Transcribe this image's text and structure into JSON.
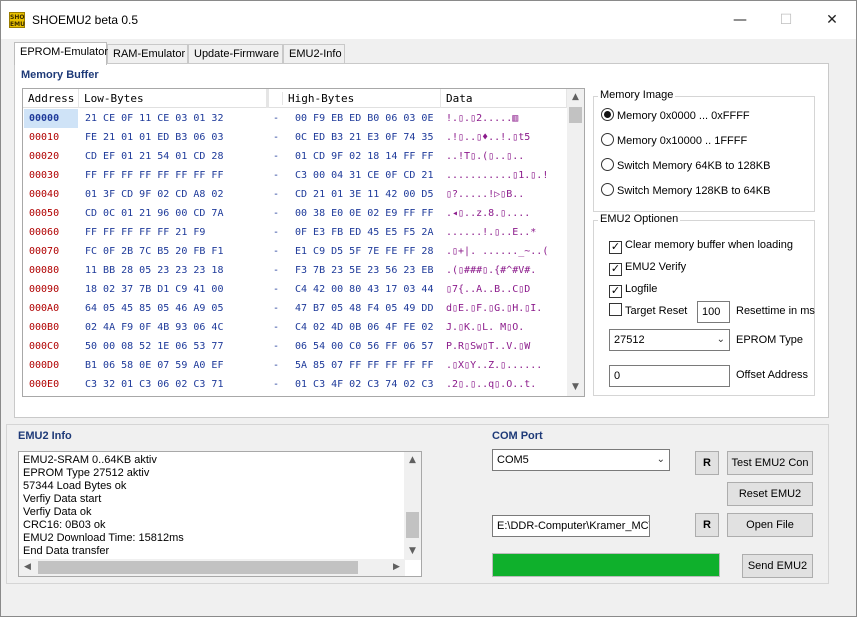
{
  "window": {
    "title": "SHOEMU2 beta 0.5",
    "icon_text": "SHO EMU",
    "minimize": "—",
    "maximize": "☐",
    "close": "✕"
  },
  "tabs": [
    {
      "label": "EPROM-Emulator",
      "active": true
    },
    {
      "label": "RAM-Emulator",
      "active": false
    },
    {
      "label": "Update-Firmware",
      "active": false
    },
    {
      "label": "EMU2-Info",
      "active": false
    }
  ],
  "memory_buffer": {
    "title": "Memory Buffer",
    "headers": [
      "Address",
      "Low-Bytes",
      "",
      "High-Bytes",
      "Data"
    ],
    "rows": [
      {
        "address": "00000",
        "low": "21 CE 0F 11 CE 03 01 32",
        "sep": "-",
        "high": "00 F9 EB ED B0 06 03 0E",
        "data": "!.▯.▯2.....▥"
      },
      {
        "address": "00010",
        "low": "FE 21 01 01 ED B3 06 03",
        "sep": "-",
        "high": "0C ED B3 21 E3 0F 74 35",
        "data": ".!▯..▯♦..!.▯t5"
      },
      {
        "address": "00020",
        "low": "CD EF 01 21 54 01 CD 28",
        "sep": "-",
        "high": "01 CD 9F 02 18 14 FF FF",
        "data": "..!T▯.(▯..▯.."
      },
      {
        "address": "00030",
        "low": "FF FF FF FF FF FF FF FF",
        "sep": "-",
        "high": "C3 00 04 31 CE 0F CD 21",
        "data": "...........▯1.▯.!"
      },
      {
        "address": "00040",
        "low": "01 3F CD 9F 02 CD A8 02",
        "sep": "-",
        "high": "CD 21 01 3E 11 42 00 D5",
        "data": "▯?.....!▷▯B.."
      },
      {
        "address": "00050",
        "low": "CD 0C 01 21 96 00 CD 7A",
        "sep": "-",
        "high": "00 38 E0 0E 02 E9 FF FF",
        "data": ".◂▯..z.8.▯...."
      },
      {
        "address": "00060",
        "low": "FF FF FF FF FF 21 F9",
        "sep": "-",
        "high": "0F E3 FB ED 45 E5 F5 2A",
        "data": "......!.▯..E..*"
      },
      {
        "address": "00070",
        "low": "FC 0F 2B 7C B5 20 FB F1",
        "sep": "-",
        "high": "E1 C9 D5 5F 7E FE FF 28",
        "data": ".▯+|. ......_~..("
      },
      {
        "address": "00080",
        "low": "11 BB 28 05 23 23 23 18",
        "sep": "-",
        "high": "F3 7B 23 5E 23 56 23 EB",
        "data": ".(▯###▯.{#^#V#."
      },
      {
        "address": "00090",
        "low": "18 02 37 7B D1 C9 41 00",
        "sep": "-",
        "high": "C4 42 00 80 43 17 03 44",
        "data": "▯7{..A..B..C▯D"
      },
      {
        "address": "000A0",
        "low": "64 05 45 85 05 46 A9 05",
        "sep": "-",
        "high": "47 B7 05 48 F4 05 49 DD",
        "data": "d▯E.▯F.▯G.▯H.▯I."
      },
      {
        "address": "000B0",
        "low": "02 4A F9 0F 4B 93 06 4C",
        "sep": "-",
        "high": "C4 02 4D 0B 06 4F FE 02",
        "data": "J.▯K.▯L. M▯O."
      },
      {
        "address": "000C0",
        "low": "50 00 08 52 1E 06 53 77",
        "sep": "-",
        "high": "06 54 00 C0 56 FF 06 57",
        "data": "P.R▯Sw▯T..V.▯W"
      },
      {
        "address": "000D0",
        "low": "B1 06 58 0E 07 59 A0 EF",
        "sep": "-",
        "high": "5A 85 07 FF FF FF FF FF",
        "data": ".▯X▯Y..Z.▯......"
      },
      {
        "address": "000E0",
        "low": "C3 32 01 C3 06 02 C3 71",
        "sep": "-",
        "high": "01 C3 4F 02 C3 74 02 C3",
        "data": ".2▯.▯..q▯.O..t."
      }
    ]
  },
  "memory_image": {
    "title": "Memory Image",
    "options": [
      {
        "label": "Memory 0x0000 ... 0xFFFF",
        "selected": true
      },
      {
        "label": "Memory 0x10000 .. 1FFFF",
        "selected": false
      },
      {
        "label": "Switch Memory 64KB to 128KB",
        "selected": false
      },
      {
        "label": "Switch Memory 128KB to 64KB",
        "selected": false
      }
    ]
  },
  "emu2_options": {
    "title": "EMU2 Optionen",
    "clear_memory": {
      "label": "Clear memory buffer when loading",
      "checked": true
    },
    "emu2_verify": {
      "label": "EMU2 Verify",
      "checked": true
    },
    "logfile": {
      "label": "Logfile",
      "checked": true
    },
    "target_reset": {
      "label": "Target Reset",
      "checked": false
    },
    "resettime_value": "100",
    "resettime_label": "Resettime in ms",
    "eprom_type_value": "27512",
    "eprom_type_label": "EPROM Type",
    "offset_value": "0",
    "offset_label": "Offset Address"
  },
  "emu2_info": {
    "title": "EMU2 Info",
    "log_lines": [
      "EMU2-SRAM 0..64KB aktiv",
      "EPROM Type 27512 aktiv",
      "57344 Load Bytes ok",
      "Verfiy Data start",
      "Verfiy Data ok",
      "CRC16: 0B03 ok",
      "EMU2 Download Time: 15812ms",
      "End Data transfer"
    ]
  },
  "com_port": {
    "title": "COM Port",
    "port_value": "COM5",
    "refresh_label": "R",
    "test_button": "Test EMU2 Con",
    "reset_button": "Reset EMU2",
    "file_path": "E:\\DDR-Computer\\Kramer_MC\\",
    "open_file_button": "Open File",
    "send_button": "Send EMU2",
    "progress_percent": 100,
    "progress_color": "#0fb02c"
  }
}
